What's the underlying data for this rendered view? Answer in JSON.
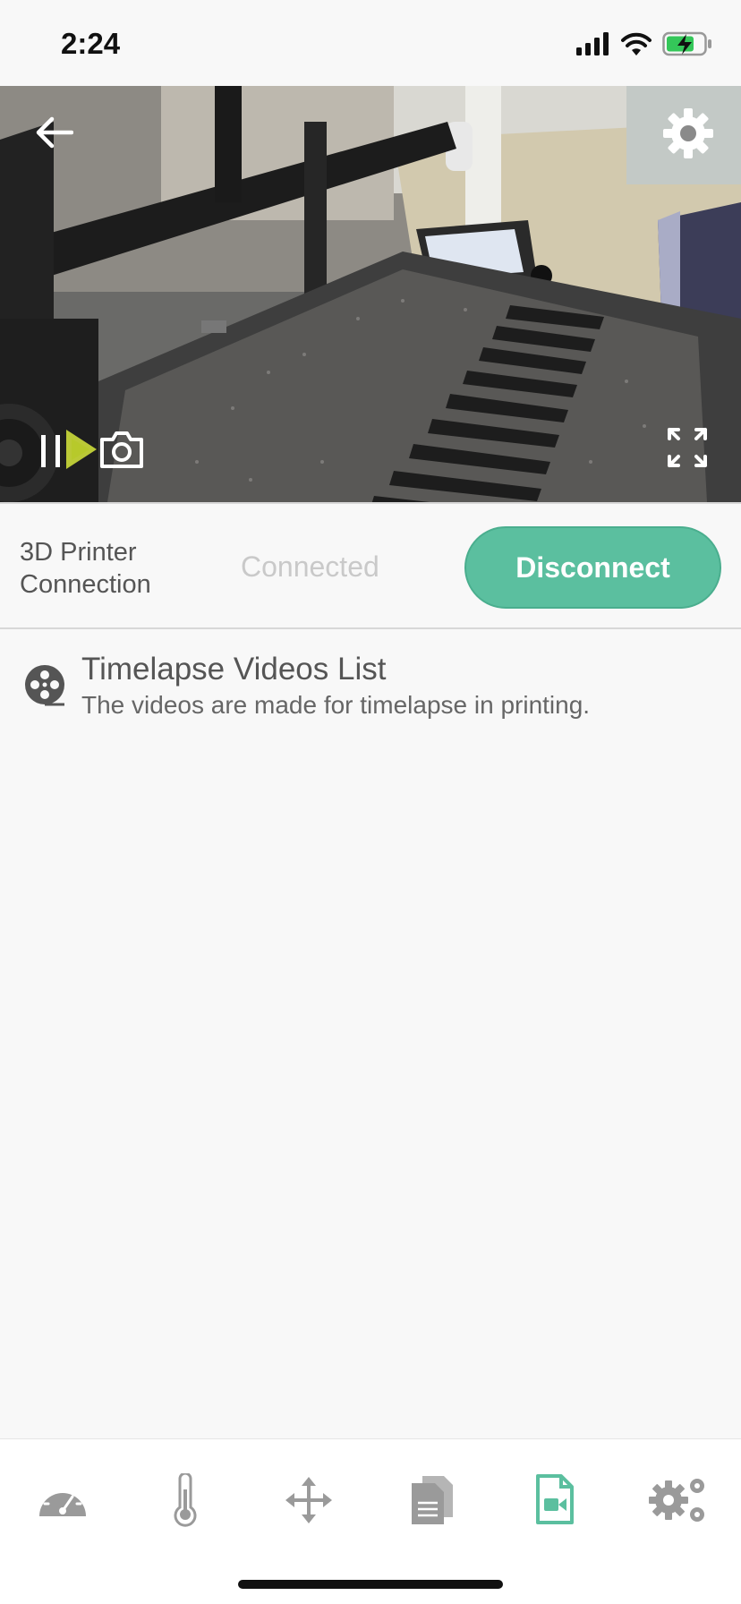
{
  "status_bar": {
    "time": "2:24"
  },
  "camera": {
    "back_icon": "arrow-left-icon",
    "settings_icon": "gear-icon",
    "play_pause_icon": "play-pause-icon",
    "snapshot_icon": "camera-icon",
    "fullscreen_icon": "fullscreen-icon"
  },
  "connection": {
    "label": "3D Printer Connection",
    "status": "Connected",
    "button_label": "Disconnect"
  },
  "timelapse": {
    "icon": "film-reel-icon",
    "title": "Timelapse Videos List",
    "subtitle": "The videos are made for timelapse in printing."
  },
  "tabs": [
    {
      "name": "dashboard",
      "icon": "speedometer-icon",
      "active": false
    },
    {
      "name": "temperature",
      "icon": "thermometer-icon",
      "active": false
    },
    {
      "name": "move",
      "icon": "move-arrows-icon",
      "active": false
    },
    {
      "name": "files",
      "icon": "documents-icon",
      "active": false
    },
    {
      "name": "timelapse",
      "icon": "video-file-icon",
      "active": true
    },
    {
      "name": "settings",
      "icon": "gears-icon",
      "active": false
    }
  ],
  "colors": {
    "accent": "#5bbf9f",
    "inactive_icon": "#9a9a9a",
    "background": "#f8f8f8"
  }
}
